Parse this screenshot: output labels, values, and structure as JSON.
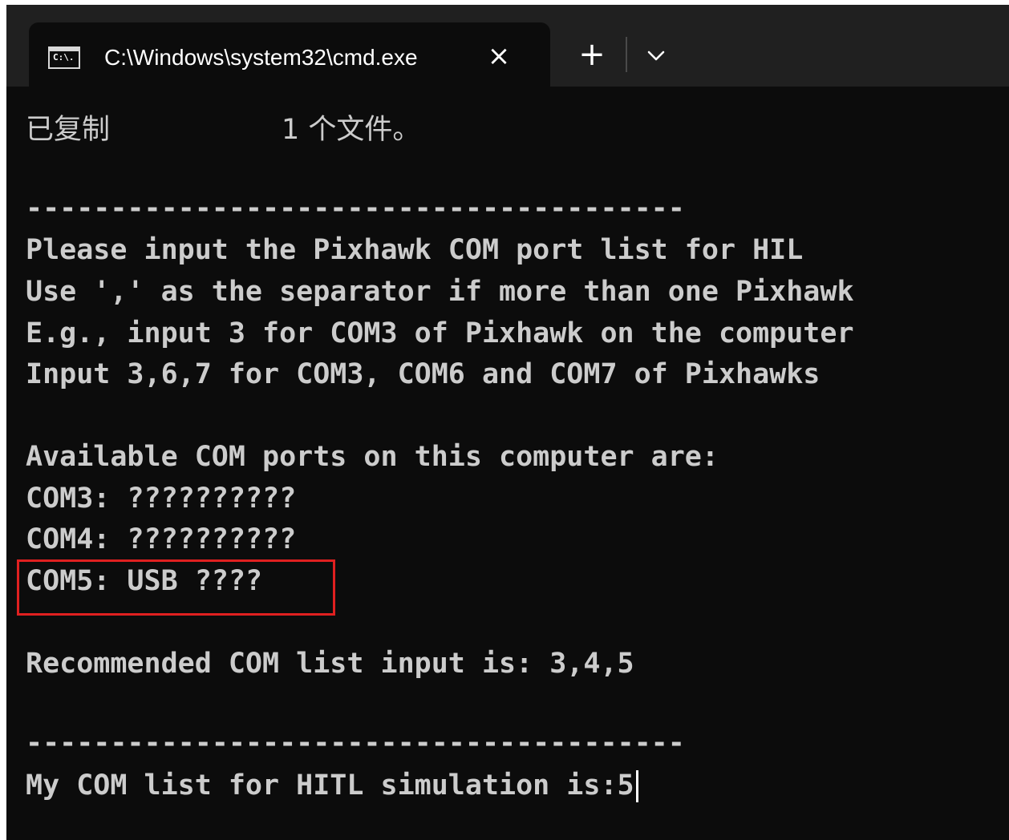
{
  "window": {
    "tab": {
      "icon_label": "C:\\.",
      "title": "C:\\Windows\\system32\\cmd.exe",
      "close_icon": "×",
      "icon": "cmd-icon"
    },
    "new_tab_icon": "+",
    "dropdown_icon": "chevron-down-icon"
  },
  "console": {
    "copy_status": {
      "label": "已复制",
      "count": "1 个文件。"
    },
    "separator_1": "---------------------------------------",
    "instructions": [
      "Please input the Pixhawk COM port list for HIL",
      "Use ',' as the separator if more than one Pixhawk",
      "E.g., input 3 for COM3 of Pixhawk on the computer",
      "Input 3,6,7 for COM3, COM6 and COM7 of Pixhawks"
    ],
    "available_header": "Available COM ports on this computer are:",
    "ports": [
      "COM3: ??????????",
      "COM4: ??????????",
      "COM5: USB ????"
    ],
    "recommended": "Recommended COM list input is: 3,4,5",
    "separator_2": "---------------------------------------",
    "prompt": "My COM list for HITL simulation is:",
    "input_value": "5"
  },
  "colors": {
    "background": "#0c0c0c",
    "tabbar": "#202020",
    "text": "#cccccc",
    "highlight": "#e02020"
  }
}
